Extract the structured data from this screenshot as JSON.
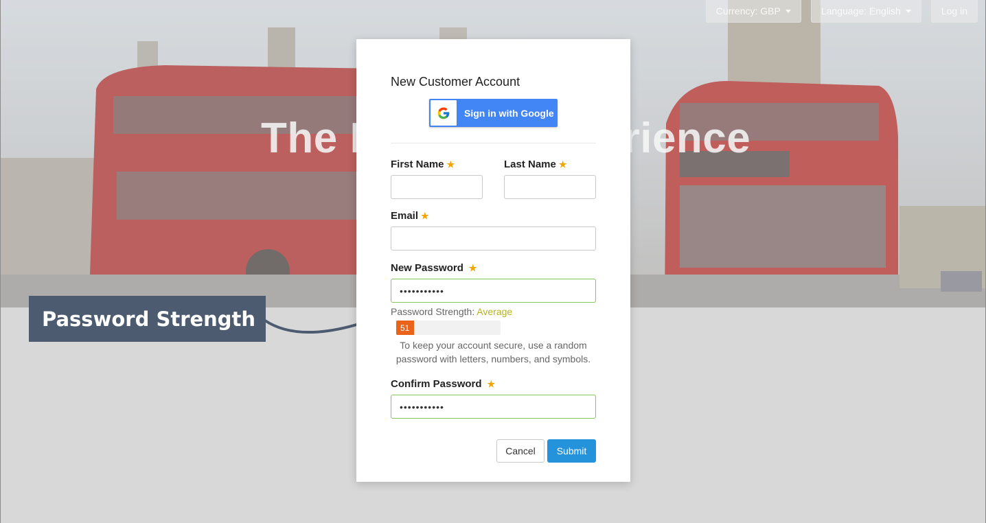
{
  "hero": {
    "title": "The London Experience"
  },
  "topnav": {
    "currency": "Currency: GBP",
    "language": "Language: English",
    "login": "Log in"
  },
  "annotation": {
    "label": "Password Strength"
  },
  "modal": {
    "title": "New Customer Account",
    "google_button": "Sign in with Google",
    "fields": {
      "first_name": {
        "label": "First Name",
        "value": ""
      },
      "last_name": {
        "label": "Last Name",
        "value": ""
      },
      "email": {
        "label": "Email",
        "value": ""
      },
      "new_password": {
        "label": "New Password",
        "value": "•••••••••••"
      },
      "confirm_password": {
        "label": "Confirm Password",
        "value": "•••••••••••"
      }
    },
    "required_marker": "★",
    "strength": {
      "prefix": "Password Strength:",
      "level": "Average",
      "score": "51",
      "score_fraction": 0.17
    },
    "help_text": "To keep your account secure, use a random password with letters, numbers, and symbols.",
    "cancel": "Cancel",
    "submit": "Submit"
  },
  "colors": {
    "annotation_bg": "#4c5b70",
    "submit_bg": "#2593dc",
    "google_blue": "#4285f4",
    "strength_fill": "#e9641a",
    "strength_level": "#b6b320",
    "required_star": "#f0a500",
    "valid_border": "#86c35a"
  },
  "icons": {
    "google": "google-g-icon",
    "arrow": "curved-arrow-icon",
    "caret": "caret-down-icon"
  }
}
